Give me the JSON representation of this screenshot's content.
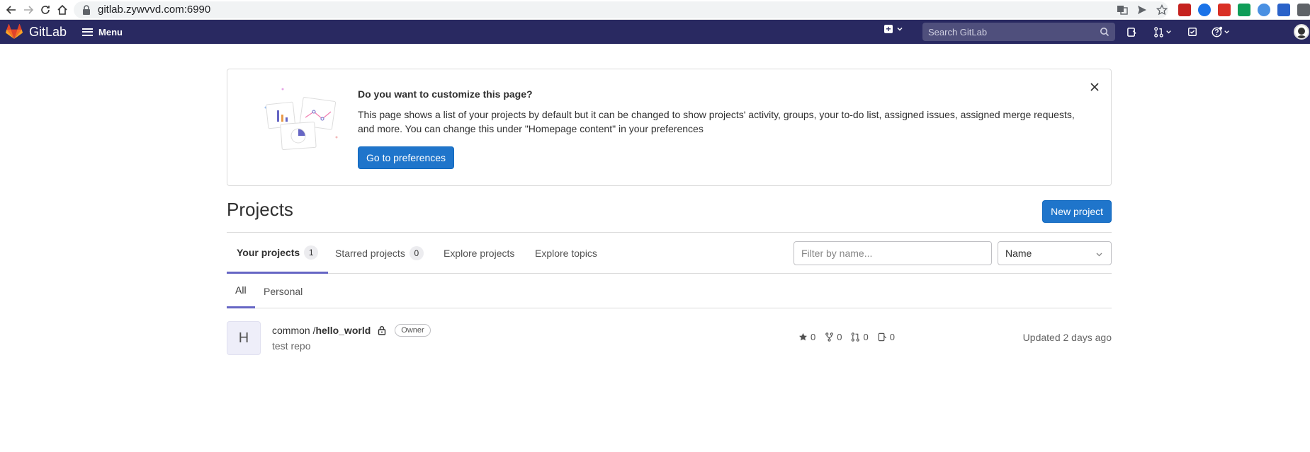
{
  "browser": {
    "url": "gitlab.zywvvd.com:6990"
  },
  "header": {
    "logo_text": "GitLab",
    "menu_label": "Menu",
    "search_placeholder": "Search GitLab"
  },
  "callout": {
    "title": "Do you want to customize this page?",
    "body": "This page shows a list of your projects by default but it can be changed to show projects' activity, groups, your to-do list, assigned issues, assigned merge requests, and more. You can change this under \"Homepage content\" in your preferences",
    "button_label": "Go to preferences"
  },
  "projects": {
    "title": "Projects",
    "new_project_label": "New project",
    "tabs": [
      {
        "label": "Your projects",
        "count": "1"
      },
      {
        "label": "Starred projects",
        "count": "0"
      },
      {
        "label": "Explore projects"
      },
      {
        "label": "Explore topics"
      }
    ],
    "filter_placeholder": "Filter by name...",
    "sort_value": "Name",
    "subtabs": [
      {
        "label": "All"
      },
      {
        "label": "Personal"
      }
    ],
    "list": [
      {
        "avatar_letter": "H",
        "namespace": "common / ",
        "name": "hello_world",
        "role": "Owner",
        "description": "test repo",
        "stars": "0",
        "forks": "0",
        "merge_requests": "0",
        "issues": "0",
        "updated": "Updated 2 days ago"
      }
    ]
  }
}
